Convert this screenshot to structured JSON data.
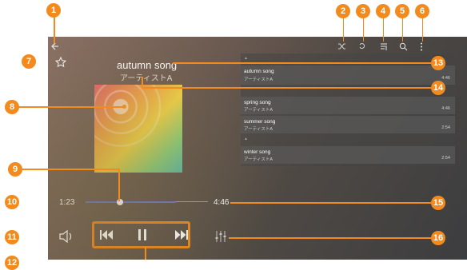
{
  "player": {
    "song_title": "autumn song",
    "artist": "アーティストA",
    "elapsed": "1:23",
    "duration": "4:46",
    "progress_fraction": 0.29
  },
  "toolbar": {
    "icons": [
      "back-arrow-icon",
      "shuffle-icon",
      "repeat-icon",
      "queue-icon",
      "search-icon",
      "overflow-menu-icon"
    ]
  },
  "playlist": {
    "items": [
      {
        "title": "autumn song",
        "artist": "アーティストA",
        "duration": "4:46"
      },
      {
        "title": "spring song",
        "artist": "アーティストA",
        "duration": "4:46"
      },
      {
        "title": "summer song",
        "artist": "アーティストA",
        "duration": "2:54"
      },
      {
        "title": "winter song",
        "artist": "アーティストA",
        "duration": "2:54"
      }
    ]
  },
  "callouts": [
    "1",
    "2",
    "3",
    "4",
    "5",
    "6",
    "7",
    "8",
    "9",
    "10",
    "11",
    "12",
    "13",
    "14",
    "15",
    "16"
  ],
  "colors": {
    "accent": "#f28a1e",
    "progress": "#6c78c8"
  }
}
